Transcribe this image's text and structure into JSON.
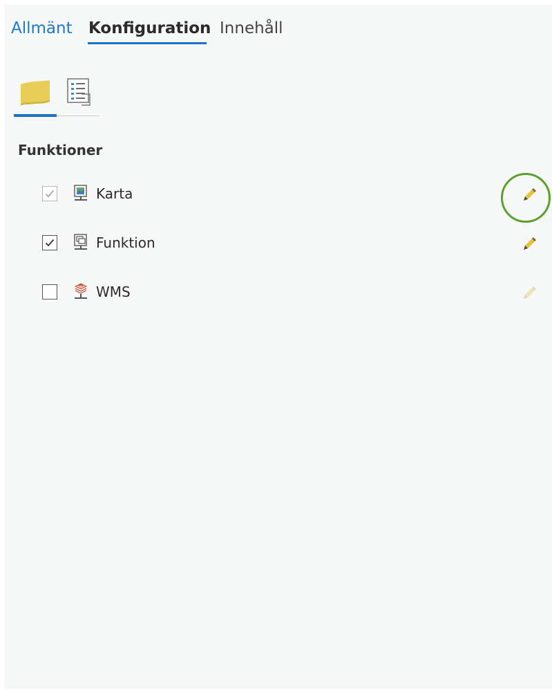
{
  "tabs": {
    "general": "Allmänt",
    "configuration": "Konfiguration",
    "content": "Innehåll",
    "active": "configuration"
  },
  "subtabs": [
    {
      "icon": "map-icon",
      "active": true
    },
    {
      "icon": "list-properties-icon",
      "active": false
    }
  ],
  "section": {
    "title": "Funktioner"
  },
  "features": [
    {
      "label": "Karta",
      "checked": true,
      "enabled": false,
      "icon": "map-server-icon",
      "edit_enabled": true,
      "highlighted": true
    },
    {
      "label": "Funktion",
      "checked": true,
      "enabled": true,
      "icon": "feature-server-icon",
      "edit_enabled": true,
      "highlighted": false
    },
    {
      "label": "WMS",
      "checked": false,
      "enabled": true,
      "icon": "wms-server-icon",
      "edit_enabled": false,
      "highlighted": false
    }
  ],
  "colors": {
    "accent": "#1a73c8",
    "link": "#1f78c8",
    "highlight": "#5aa02c",
    "panel_bg": "#f6f7f7"
  }
}
